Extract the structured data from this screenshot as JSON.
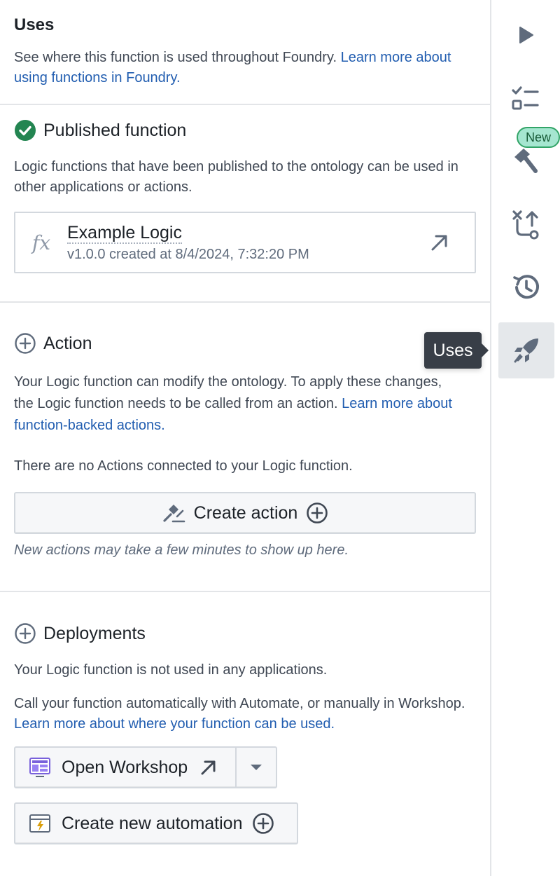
{
  "uses": {
    "title": "Uses",
    "description": "See where this function is used throughout Foundry. ",
    "link": "Learn more about using functions in Foundry."
  },
  "published": {
    "title": "Published function",
    "description": "Logic functions that have been published to the ontology can be used in other applications or actions.",
    "card": {
      "icon_label": "fx",
      "name": "Example Logic",
      "meta": "v1.0.0 created at 8/4/2024, 7:32:20 PM"
    }
  },
  "action": {
    "title": "Action",
    "description": "Your Logic function can modify the ontology. To apply these changes, the Logic function needs to be called from an action. ",
    "link": "Learn more about function-backed actions.",
    "empty_text": "There are no Actions connected to your Logic function.",
    "create_button": "Create action",
    "note": "New actions may take a few minutes to show up here."
  },
  "deployments": {
    "title": "Deployments",
    "status_text": "Your Logic function is not used in any applications.",
    "description": "Call your function automatically with Automate, or manually in Workshop. ",
    "link": "Learn more about where your function can be used.",
    "open_workshop_button": "Open Workshop",
    "create_automation_button": "Create new automation"
  },
  "rail": {
    "icons": [
      "play-icon",
      "checklist-icon",
      "hammer-icon",
      "merge-icon",
      "history-icon",
      "rocket-icon"
    ],
    "badge": "New",
    "tooltip": "Uses",
    "active": "rocket-icon"
  },
  "colors": {
    "link": "#215db0",
    "success": "#238551",
    "badge_bg": "#a5e6d0",
    "tooltip_bg": "#383e47"
  }
}
